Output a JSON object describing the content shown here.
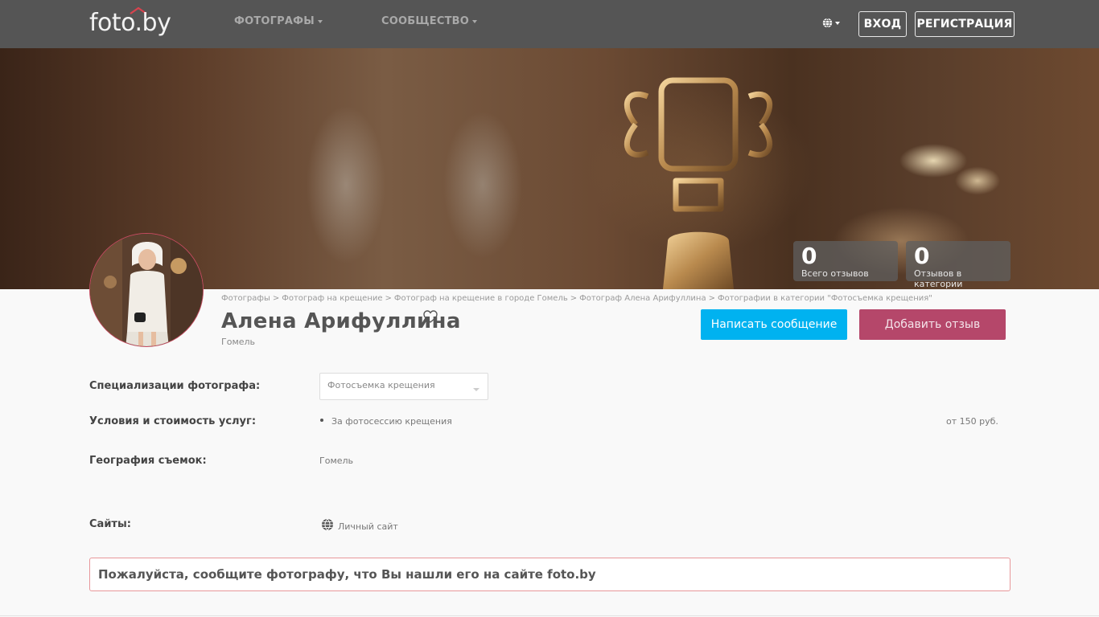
{
  "site": {
    "logo_text": "foto.by"
  },
  "nav": {
    "photographers": "ФОТОГРАФЫ",
    "community": "СООБЩЕСТВО",
    "login": "ВХОД",
    "register": "РЕГИСТРАЦИЯ"
  },
  "stats": {
    "total_reviews_count": "0",
    "total_reviews_label": "Всего отзывов",
    "category_reviews_count": "0",
    "category_reviews_label": "Отзывов в категории"
  },
  "breadcrumb": [
    "Фотографы",
    "Фотограф на крещение",
    "Фотограф на крещение в городе Гомель",
    "Фотограф Алена Арифуллина",
    "Фотографии в категории \"Фотосъемка крещения\""
  ],
  "breadcrumb_separator": ">",
  "profile": {
    "name": "Алена Арифуллина",
    "city": "Гомель"
  },
  "actions": {
    "message": "Написать сообщение",
    "review": "Добавить отзыв"
  },
  "details": {
    "specializations_label": "Специализации фотографа:",
    "specialization_selected": "Фотосъемка крещения",
    "conditions_label": "Условия и стоимость услуг:",
    "services": [
      {
        "name": "За фотосессию крещения",
        "price": "от 150 руб."
      }
    ],
    "geography_label": "География съемок:",
    "geography_value": "Гомель",
    "sites_label": "Сайты:",
    "site_link": "Личный сайт"
  },
  "notice": "Пожалуйста, сообщите фотографу, что Вы нашли его на сайте foto.by",
  "colors": {
    "navbar": "#555555",
    "message_button": "#00b2f0",
    "review_button": "#b5476a",
    "notice_border": "#e8979a"
  },
  "icons": {
    "language": "globe-icon",
    "favorite": "heart-icon",
    "site": "globe-icon"
  }
}
